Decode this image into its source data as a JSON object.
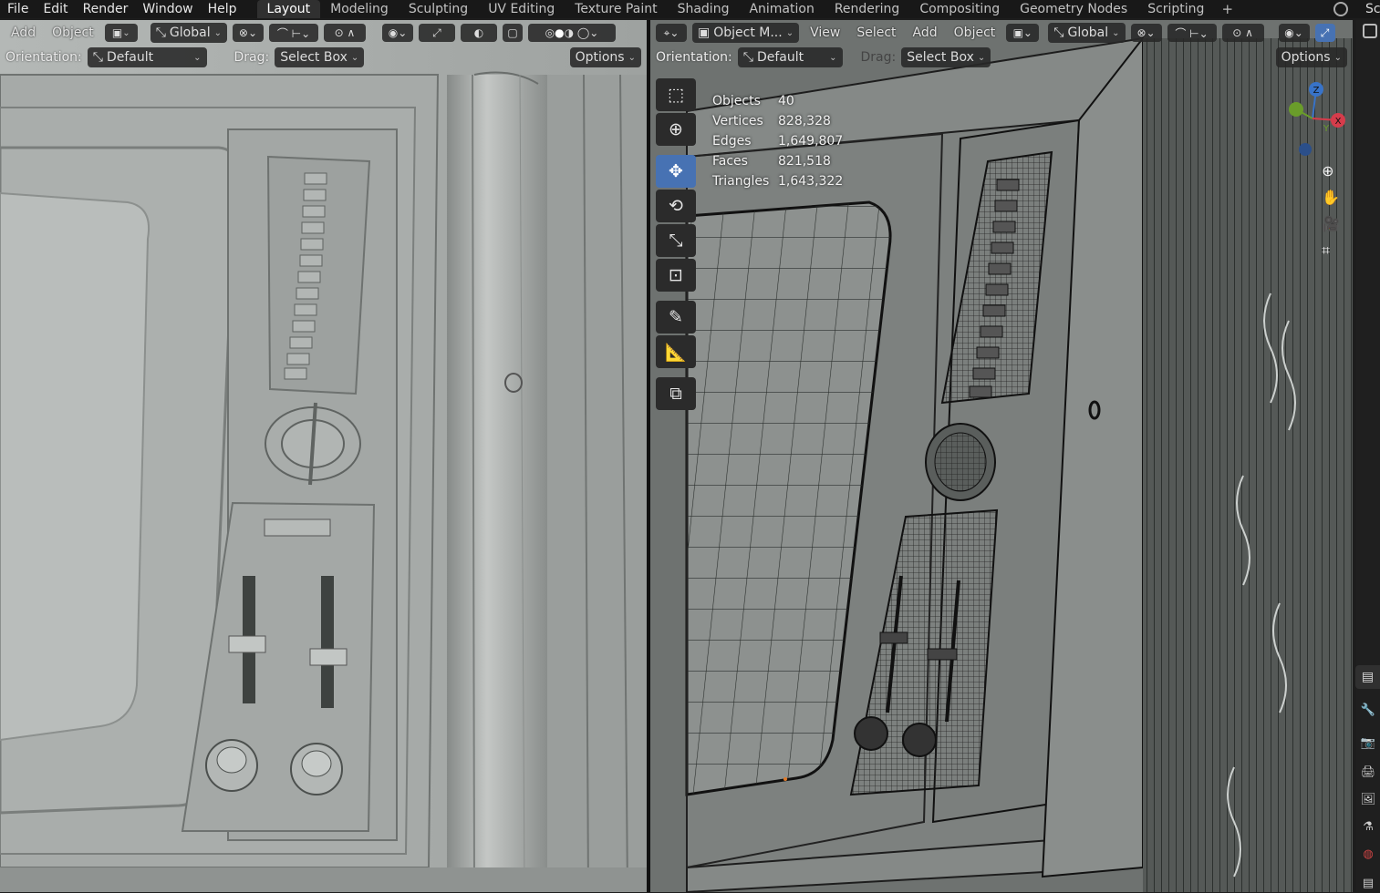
{
  "menu": [
    "File",
    "Edit",
    "Render",
    "Window",
    "Help"
  ],
  "workspaces": {
    "tabs": [
      "Layout",
      "Modeling",
      "Sculpting",
      "UV Editing",
      "Texture Paint",
      "Shading",
      "Animation",
      "Rendering",
      "Compositing",
      "Geometry Nodes",
      "Scripting"
    ],
    "active": "Layout",
    "add_label": "+",
    "scene_label_partial": "Sc"
  },
  "left_viewport": {
    "header": {
      "add": "Add",
      "object": "Object",
      "transform_orientation": "Global",
      "shading_mode": "solid"
    },
    "tool_settings": {
      "orientation_label": "Orientation:",
      "orientation_value": "Default",
      "drag_label": "Drag:",
      "drag_value": "Select Box",
      "options": "Options"
    }
  },
  "right_viewport": {
    "header": {
      "mode": "Object M...",
      "view": "View",
      "select": "Select",
      "add": "Add",
      "object": "Object",
      "transform_orientation": "Global"
    },
    "tool_settings": {
      "orientation_label": "Orientation:",
      "orientation_value": "Default",
      "drag_label": "Drag:",
      "drag_value": "Select Box",
      "options": "Options"
    },
    "stats": [
      {
        "label": "Objects",
        "value": "40"
      },
      {
        "label": "Vertices",
        "value": "828,328"
      },
      {
        "label": "Edges",
        "value": "1,649,807"
      },
      {
        "label": "Faces",
        "value": "821,518"
      },
      {
        "label": "Triangles",
        "value": "1,643,322"
      }
    ],
    "tools": [
      "select-box-tool",
      "cursor-tool",
      "move-tool",
      "rotate-tool",
      "scale-tool",
      "transform-tool",
      "annotate-tool",
      "measure-tool",
      "add-cube-tool"
    ],
    "active_tool": "move-tool",
    "gizmo_axes": [
      "Z",
      "Y",
      "X"
    ]
  },
  "colors": {
    "active_blue": "#4772b3",
    "axis_x": "#d63c4b",
    "axis_y": "#6a9d2a",
    "axis_z": "#3873c8",
    "solid_bg": "#9fa3a1"
  }
}
